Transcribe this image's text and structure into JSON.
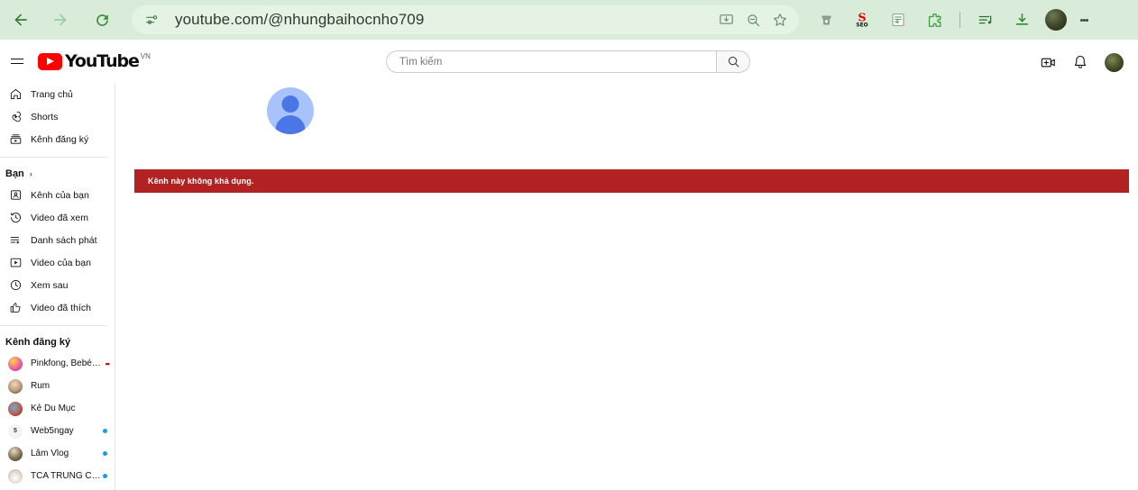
{
  "browser": {
    "url": "youtube.com/@nhungbaihocnho709",
    "back_label": "Back",
    "forward_label": "Forward",
    "reload_label": "Reload",
    "site_info_label": "View site information",
    "omnibox_actions": [
      "install-page-icon",
      "zoom-out-icon",
      "bookmark-star-icon"
    ],
    "extensions": [
      "shield-extension-icon",
      "seo-extension-icon",
      "notes-extension-icon",
      "puzzle-extensions-icon"
    ],
    "media_icon": "media-playlist-icon",
    "downloads_icon": "download-icon",
    "profile_label": "Profile",
    "menu_label": "Customize and control Google Chrome",
    "theme_color": "#d9ecd9",
    "omnibox_color": "#e4f3e4",
    "accent_color": "#3e8b3e"
  },
  "yt_header": {
    "menu_label": "Guide",
    "logo_text": "YouTube",
    "country_code": "VN",
    "create_label": "Create",
    "notifications_label": "Notifications",
    "avatar_label": "Account"
  },
  "search": {
    "placeholder": "Tìm kiếm",
    "value": "",
    "button_label": "Search"
  },
  "sidebar": {
    "primary": [
      {
        "label": "Trang chủ",
        "icon": "home-icon"
      },
      {
        "label": "Shorts",
        "icon": "shorts-icon"
      },
      {
        "label": "Kênh đăng ký",
        "icon": "subscriptions-icon"
      }
    ],
    "you_header": {
      "label": "Bạn",
      "chevron": "›"
    },
    "you_items": [
      {
        "label": "Kênh của bạn",
        "icon": "your-channel-icon"
      },
      {
        "label": "Video đã xem",
        "icon": "history-icon"
      },
      {
        "label": "Danh sách phát",
        "icon": "playlists-icon"
      },
      {
        "label": "Video của bạn",
        "icon": "your-videos-icon"
      },
      {
        "label": "Xem sau",
        "icon": "watch-later-icon"
      },
      {
        "label": "Video đã thích",
        "icon": "liked-videos-icon"
      }
    ],
    "subs_title": "Kênh đăng ký",
    "subscriptions": [
      {
        "label": "Pinkfong, Bebé T...",
        "badge": "live",
        "avatar": "#e8a0c0"
      },
      {
        "label": "Rum",
        "badge": "none",
        "avatar": "#c9b49a"
      },
      {
        "label": "Kẻ Du Mục",
        "badge": "none",
        "avatar": "#8a5a4a"
      },
      {
        "label": "Web5ngay",
        "badge": "new",
        "avatar": "#f2f2f2"
      },
      {
        "label": "Lâm Vlog",
        "badge": "new",
        "avatar": "#7a6a5a"
      },
      {
        "label": "TCA TRUNG CHÍ...",
        "badge": "new",
        "avatar": "#e8e4dc"
      }
    ]
  },
  "main": {
    "channel_avatar_label": "Channel avatar placeholder",
    "error_message": "Kênh này không khả dụng.",
    "error_color": "#b22222"
  }
}
